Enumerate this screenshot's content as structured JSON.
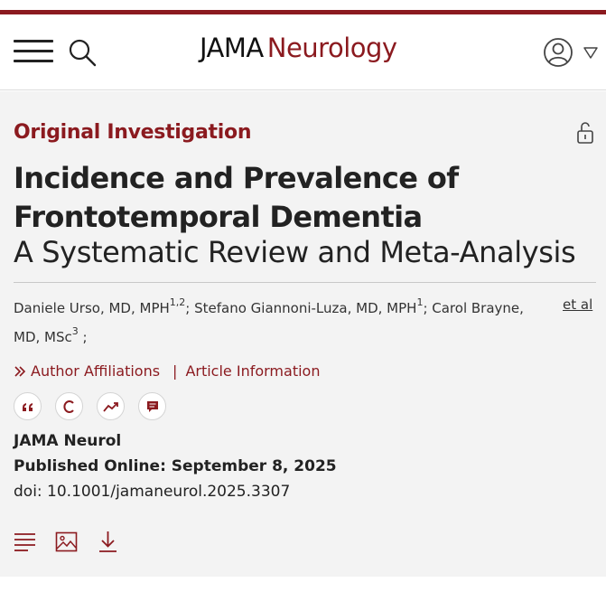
{
  "brand": {
    "part1": "JAMA",
    "part2": "Neurology"
  },
  "colors": {
    "accent": "#8b1a1f"
  },
  "header": {
    "icons": [
      "hamburger-menu-icon",
      "search-icon",
      "user-account-icon",
      "caret-down-icon"
    ]
  },
  "article": {
    "type": "Original Investigation",
    "title": "Incidence and Prevalence of Frontotemporal Dementia",
    "subtitle": "A Systematic Review and Meta-Analysis",
    "authors": [
      {
        "name": "Daniele Urso, MD, MPH",
        "sup": "1,2",
        "sep": "; "
      },
      {
        "name": "Stefano Giannoni-Luza, MD, MPH",
        "sup": "1",
        "sep": "; "
      },
      {
        "name": "Carol Brayne, MD, MSc",
        "sup": "3",
        "sep": " ;"
      }
    ],
    "etal": "et al",
    "links": {
      "affiliations": "Author Affiliations",
      "separator": "|",
      "info": "Article Information"
    },
    "tool_icons": [
      "quote-icon",
      "copyright-icon",
      "metrics-trend-icon",
      "comment-icon"
    ],
    "journal": "JAMA Neurol",
    "published": "Published Online: September 8, 2025",
    "doi": "doi: 10.1001/jamaneurol.2025.3307",
    "bottom_icons": [
      "full-text-icon",
      "figures-icon",
      "download-icon"
    ]
  }
}
